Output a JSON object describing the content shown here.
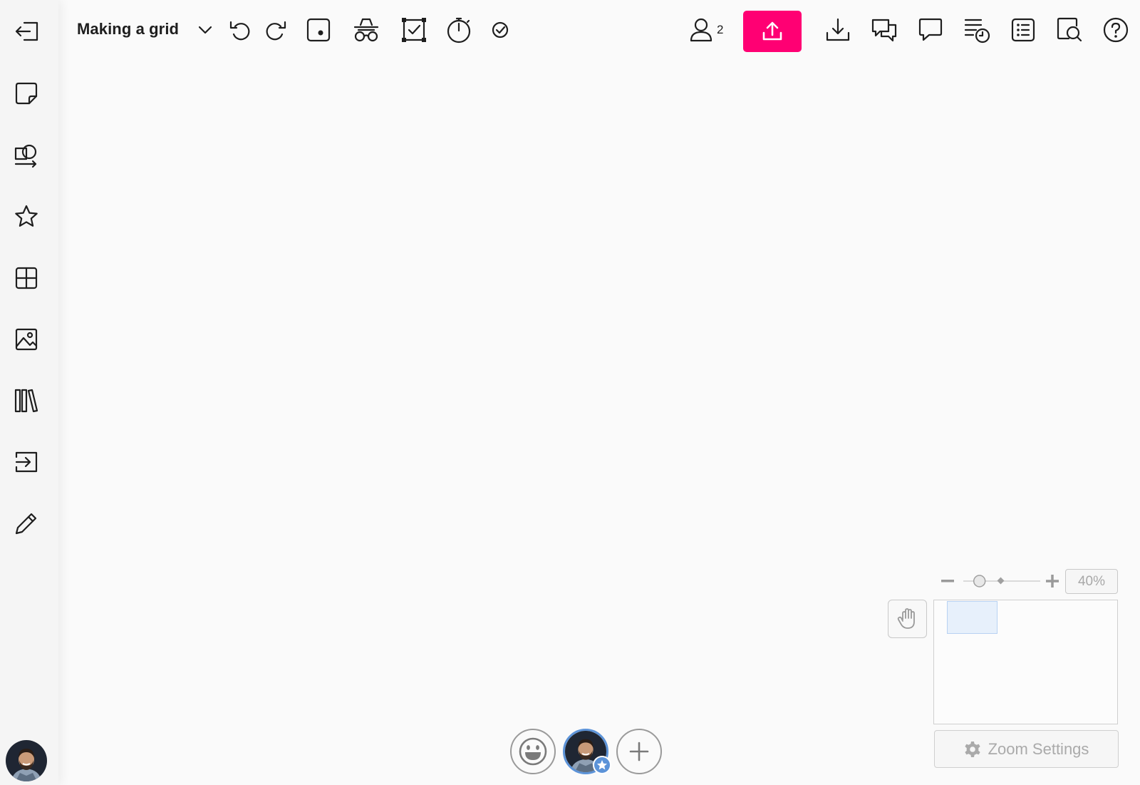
{
  "board": {
    "title": "Making a grid"
  },
  "toolbar": {
    "collaborator_count": "2"
  },
  "zoom": {
    "level_label": "40%",
    "level": 0.4,
    "settings_label": "Zoom Settings"
  },
  "colors": {
    "accent": "#ff0073",
    "user_ring": "#5c93d8"
  },
  "icons": {
    "sidebar": [
      "exit-board-icon",
      "sticky-note-icon",
      "shapes-icon",
      "star-icon",
      "grid-icon",
      "image-icon",
      "library-icon",
      "import-icon",
      "pencil-icon"
    ],
    "toolbar": [
      "chevron-down-icon",
      "undo-icon",
      "redo-icon",
      "focus-icon",
      "incognito-icon",
      "voting-icon",
      "timer-icon",
      "check-circle-icon",
      "users-icon",
      "share-upload-icon",
      "download-icon",
      "chat-icon",
      "comment-icon",
      "activity-history-icon",
      "outline-list-icon",
      "search-icon",
      "help-icon"
    ]
  }
}
